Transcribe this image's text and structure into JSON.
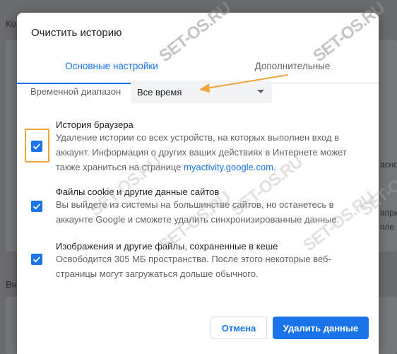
{
  "background": {
    "top_left_text": "Ко",
    "bottom_left_text": "Вн",
    "right_fragments": [
      "асно",
      "апри",
      "пле"
    ]
  },
  "watermarks": [
    "SET-OS.RU",
    "SET-OS.RU",
    "SET-OS.RU",
    "SET-OS.RU",
    "SET-OS.RU",
    "SET-OS.RU",
    "SET-OS.RU"
  ],
  "dialog": {
    "title": "Очистить историю",
    "tabs": [
      {
        "label": "Основные настройки",
        "active": true
      },
      {
        "label": "Дополнительные",
        "active": false
      }
    ],
    "time_range": {
      "label": "Временной диапазон",
      "value": "Все время"
    },
    "items": [
      {
        "title": "История браузера",
        "desc_before_link": "Удаление истории со всех устройств, на которых выполнен вход в аккаунт. Информация о других ваших действиях в Интернете может также храниться на странице ",
        "link": "myactivity.google.com",
        "desc_after_link": ".",
        "checked": true
      },
      {
        "title": "Файлы cookie и другие данные сайтов",
        "desc": "Вы выйдете из системы на большинстве сайтов, но останетесь в аккаунте Google и сможете удалить синхронизированные данные.",
        "checked": true
      },
      {
        "title": "Изображения и другие файлы, сохраненные в кеше",
        "desc": "Освободится 305 МБ пространства. После этого некоторые веб-страницы могут загружаться дольше обычного.",
        "checked": true
      }
    ],
    "buttons": {
      "cancel": "Отмена",
      "confirm": "Удалить данные"
    }
  },
  "colors": {
    "accent": "#1a73e8",
    "highlight": "#f0a43a",
    "annotation_arrow": "#f0a43a"
  }
}
